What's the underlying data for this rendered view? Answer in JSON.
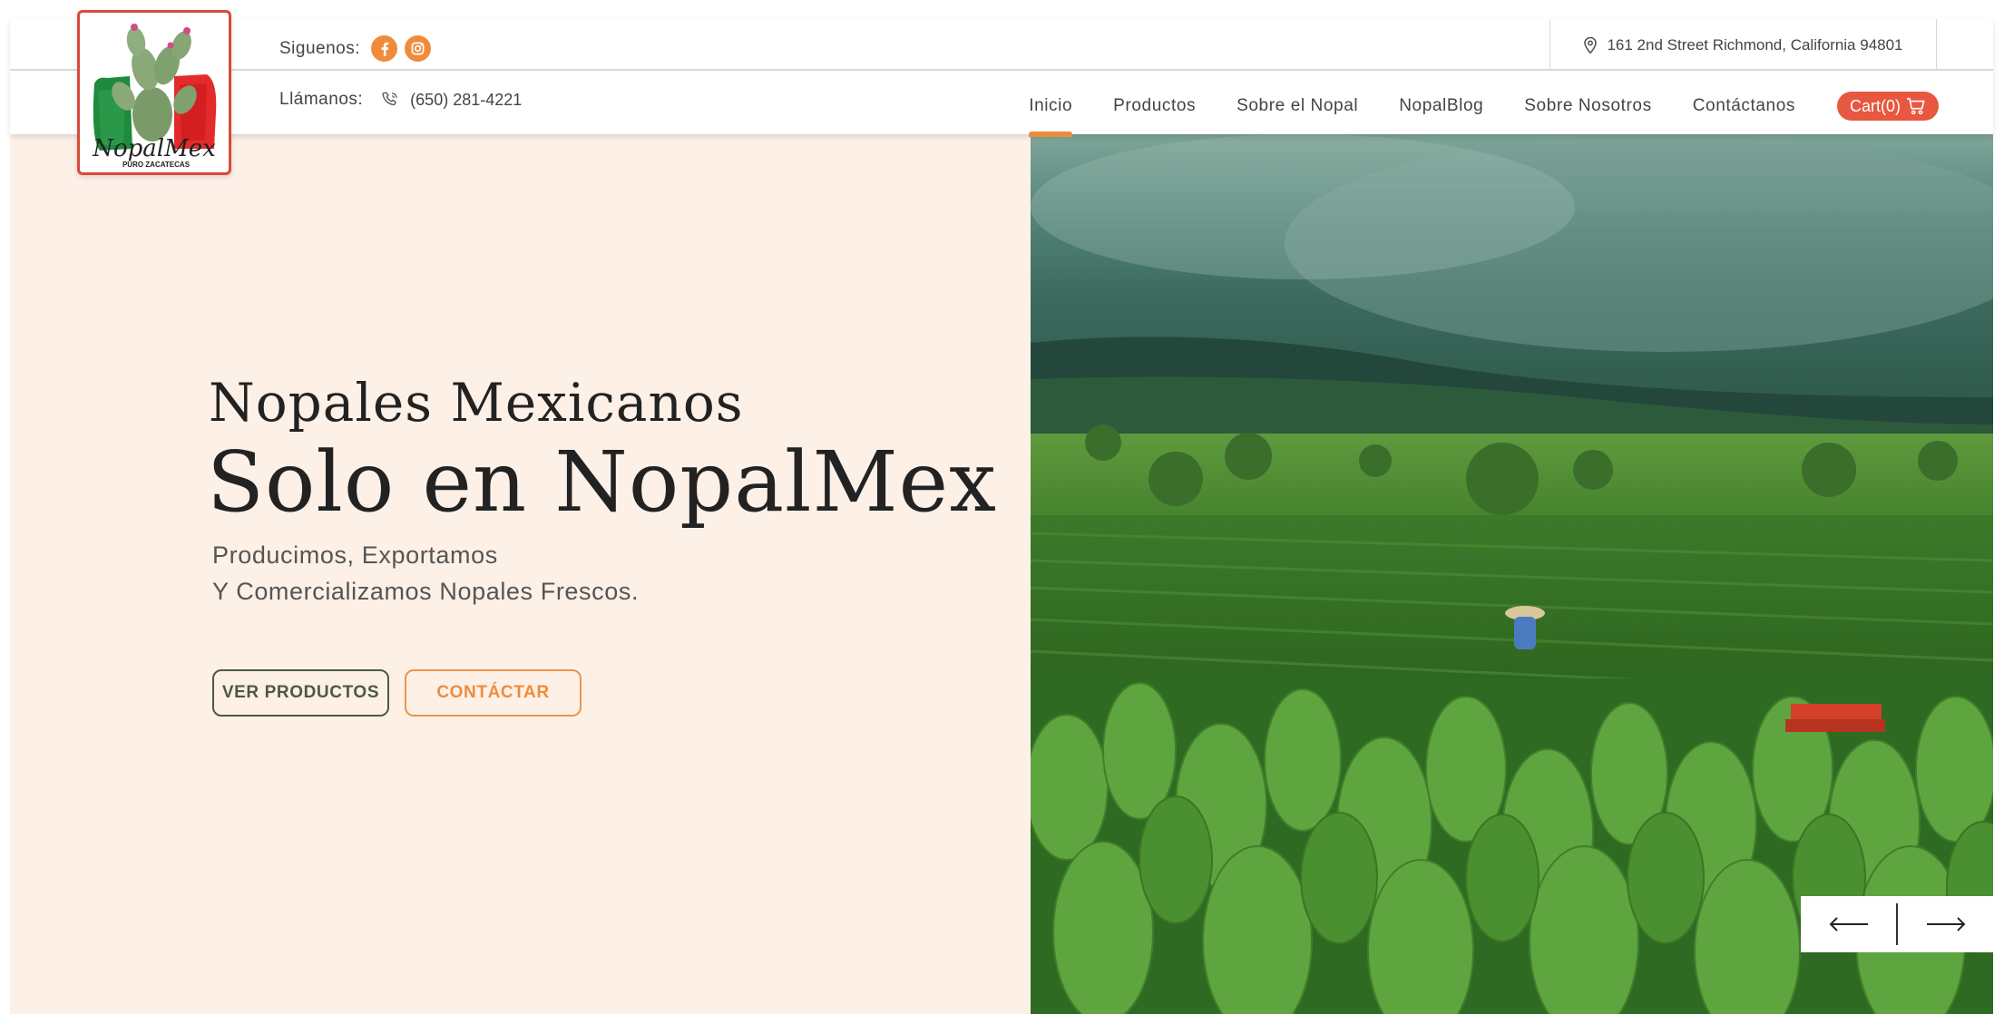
{
  "brand": {
    "name": "NopalMex",
    "tagline": "PURO ZACATECAS"
  },
  "topbar": {
    "follow_label": "Siguenos:",
    "social": [
      {
        "icon": "facebook-icon"
      },
      {
        "icon": "instagram-icon"
      }
    ],
    "address": "161 2nd Street Richmond, California 94801",
    "call_label": "Llámanos:",
    "phone": "(650) 281-4221"
  },
  "nav": {
    "items": [
      {
        "label": "Inicio",
        "active": true
      },
      {
        "label": "Productos",
        "active": false
      },
      {
        "label": "Sobre el Nopal",
        "active": false
      },
      {
        "label": "NopalBlog",
        "active": false
      },
      {
        "label": "Sobre Nosotros",
        "active": false
      },
      {
        "label": "Contáctanos",
        "active": false
      }
    ],
    "cart_label": "Cart(0)"
  },
  "hero": {
    "subtitle": "Nopales Mexicanos",
    "title": "Solo en NopalMex",
    "line1": "Producimos, Exportamos",
    "line2": "Y Comercializamos Nopales Frescos.",
    "primary_button": "VER PRODUCTOS",
    "secondary_button": "CONTÁCTAR"
  },
  "colors": {
    "accent": "#ee8c3c",
    "cart": "#e8573f",
    "hero_bg": "#fdf0e7",
    "dark_green": "#4d5a40"
  }
}
